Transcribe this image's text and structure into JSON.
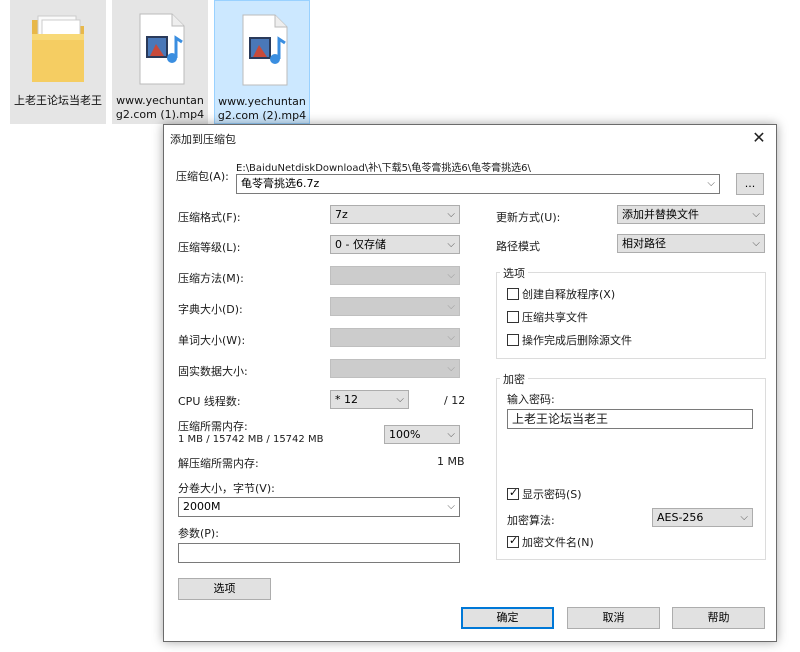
{
  "desktop": {
    "icons": [
      {
        "label": "上老王论坛当老王"
      },
      {
        "label": "www.yechuntang2.com (1).mp4"
      },
      {
        "label": "www.yechuntang2.com (2).mp4"
      }
    ]
  },
  "dialog": {
    "title": "添加到压缩包",
    "close_glyph": "✕",
    "archive": {
      "label": "压缩包(A):",
      "path": "E:\\BaiduNetdiskDownload\\补\\下载5\\龟苓膏挑选6\\龟苓膏挑选6\\",
      "name": "龟苓膏挑选6.7z",
      "browse": "..."
    },
    "left": {
      "format": {
        "label": "压缩格式(F):",
        "value": "7z"
      },
      "level": {
        "label": "压缩等级(L):",
        "value": "0 - 仅存储"
      },
      "method": {
        "label": "压缩方法(M):",
        "value": ""
      },
      "dict": {
        "label": "字典大小(D):",
        "value": ""
      },
      "word": {
        "label": "单词大小(W):",
        "value": ""
      },
      "solid": {
        "label": "固实数据大小:",
        "value": ""
      },
      "cpu": {
        "label": "CPU 线程数:",
        "value": "* 12",
        "max": "/ 12"
      },
      "mem_compress": {
        "label": "压缩所需内存:",
        "detail": "1 MB / 15742 MB / 15742 MB",
        "percent": "100%"
      },
      "mem_decompress": {
        "label": "解压缩所需内存:",
        "value": "1 MB"
      },
      "volume": {
        "label": "分卷大小，字节(V):",
        "value": "2000M"
      },
      "params": {
        "label": "参数(P):",
        "value": ""
      },
      "options_button": "选项"
    },
    "right": {
      "update": {
        "label": "更新方式(U):",
        "value": "添加并替换文件"
      },
      "path_mode": {
        "label": "路径模式",
        "value": "相对路径"
      },
      "options_group": {
        "title": "选项",
        "sfx": {
          "label": "创建自释放程序(X)",
          "checked": false
        },
        "shared": {
          "label": "压缩共享文件",
          "checked": false
        },
        "delete_after": {
          "label": "操作完成后删除源文件",
          "checked": false
        }
      },
      "encryption": {
        "title": "加密",
        "password_label": "输入密码:",
        "password_value": "上老王论坛当老王",
        "show_password": {
          "label": "显示密码(S)",
          "checked": true
        },
        "method_label": "加密算法:",
        "method_value": "AES-256",
        "encrypt_names": {
          "label": "加密文件名(N)",
          "checked": true
        }
      }
    },
    "buttons": {
      "ok": "确定",
      "cancel": "取消",
      "help": "帮助"
    },
    "dropdown_glyph": "⌵"
  }
}
